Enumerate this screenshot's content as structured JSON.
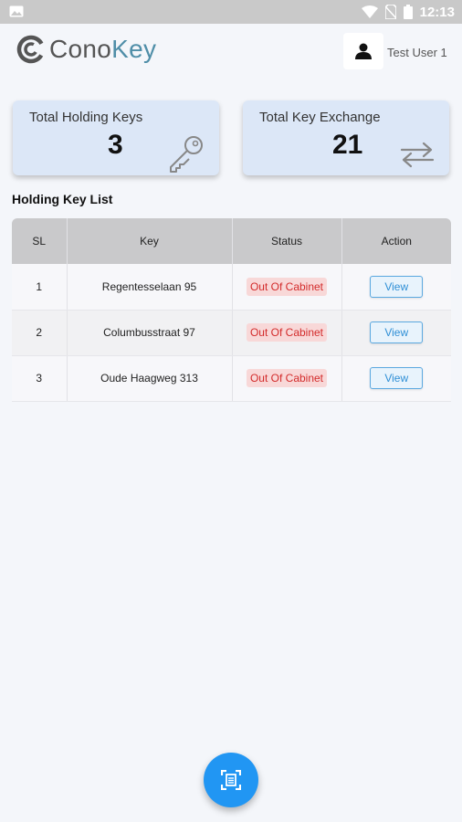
{
  "statusbar": {
    "time": "12:13"
  },
  "header": {
    "logo_prefix": "Cono",
    "logo_suffix": "Key",
    "user_name": "Test User 1"
  },
  "cards": [
    {
      "title": "Total Holding Keys",
      "value": "3",
      "icon": "key-icon"
    },
    {
      "title": "Total Key Exchange",
      "value": "21",
      "icon": "exchange-arrows-icon"
    }
  ],
  "section_title": "Holding Key List",
  "table": {
    "columns": [
      "SL",
      "Key",
      "Status",
      "Action"
    ],
    "rows": [
      {
        "sl": "1",
        "key": "Regentesselaan 95",
        "status": "Out Of Cabinet",
        "action": "View"
      },
      {
        "sl": "2",
        "key": "Columbusstraat 97",
        "status": "Out Of Cabinet",
        "action": "View"
      },
      {
        "sl": "3",
        "key": "Oude Haagweg 313",
        "status": "Out Of Cabinet",
        "action": "View"
      }
    ]
  },
  "fab": {
    "icon": "scan-document-icon"
  },
  "colors": {
    "accent": "#2196f3",
    "card_bg": "#dce7f7",
    "status_red": "#d32b2b",
    "logo_teal": "#4f8ea8"
  }
}
